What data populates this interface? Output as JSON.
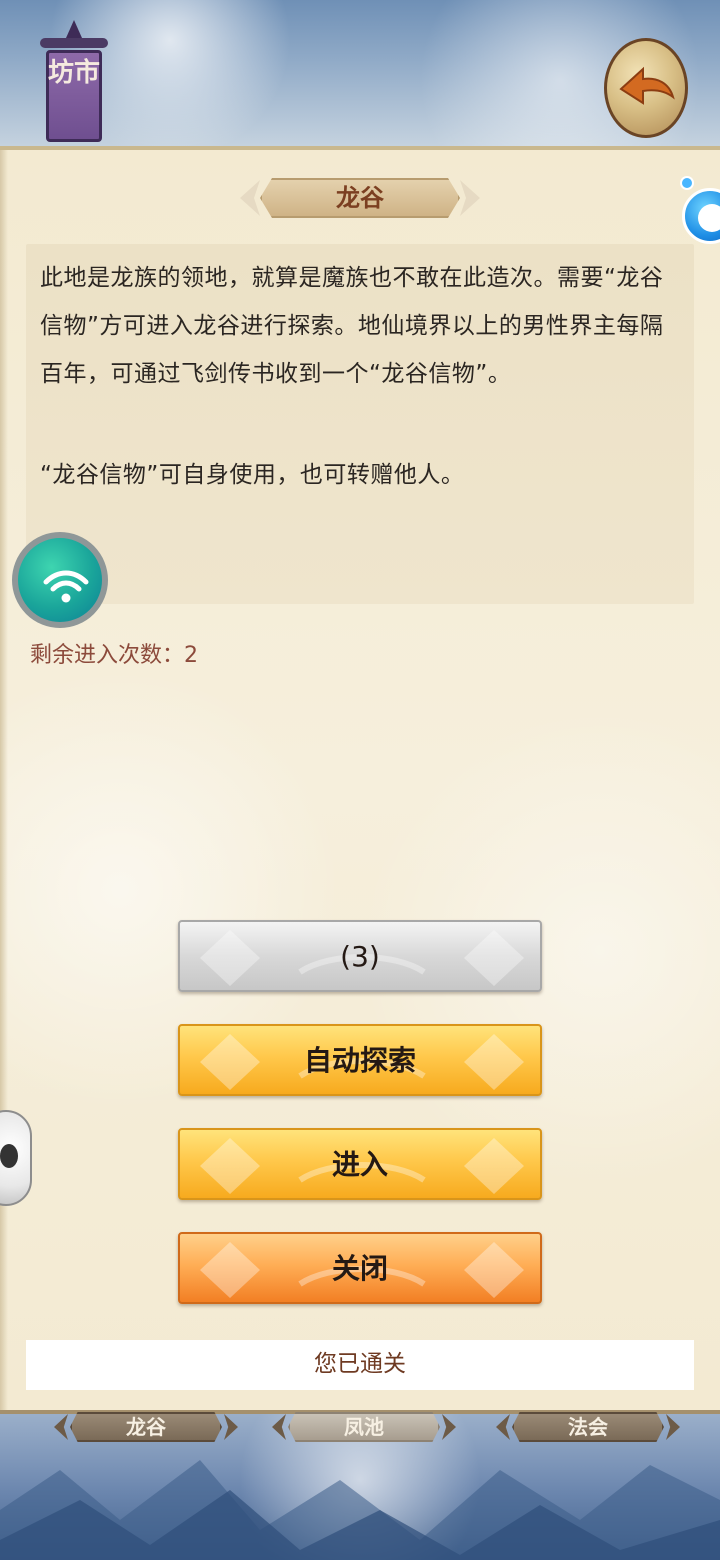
{
  "header": {
    "market_label": "坊市"
  },
  "dialog": {
    "title": "龙谷",
    "description": [
      "此地是龙族的领地，就算是魔族也不敢在此造次。需要“龙谷信物”方可进入龙谷进行探索。地仙境界以上的男性界主每隔百年，可通过飞剑传书收到一个“龙谷信物”。",
      "“龙谷信物”可自身使用，也可转赠他人。"
    ],
    "remaining_entries": "剩余进入次数：2",
    "buttons": {
      "countdown": "(3)",
      "auto_explore": "自动探索",
      "enter": "进入",
      "close": "关闭"
    },
    "status": "您已通关"
  },
  "bottom_tabs": [
    {
      "label": "龙谷"
    },
    {
      "label": "凤池"
    },
    {
      "label": "法会"
    }
  ],
  "icons": {
    "back": "back-arrow-icon",
    "wifi": "wifi-icon",
    "side_assistant": "assistant-bot-icon",
    "side_panda": "panda-icon"
  },
  "colors": {
    "title_text": "#7b3f21",
    "remaining_text": "#8c4a3b",
    "button_yellow": "#ffc84b",
    "button_orange": "#ffae56",
    "button_grey": "#d8d8d8"
  }
}
